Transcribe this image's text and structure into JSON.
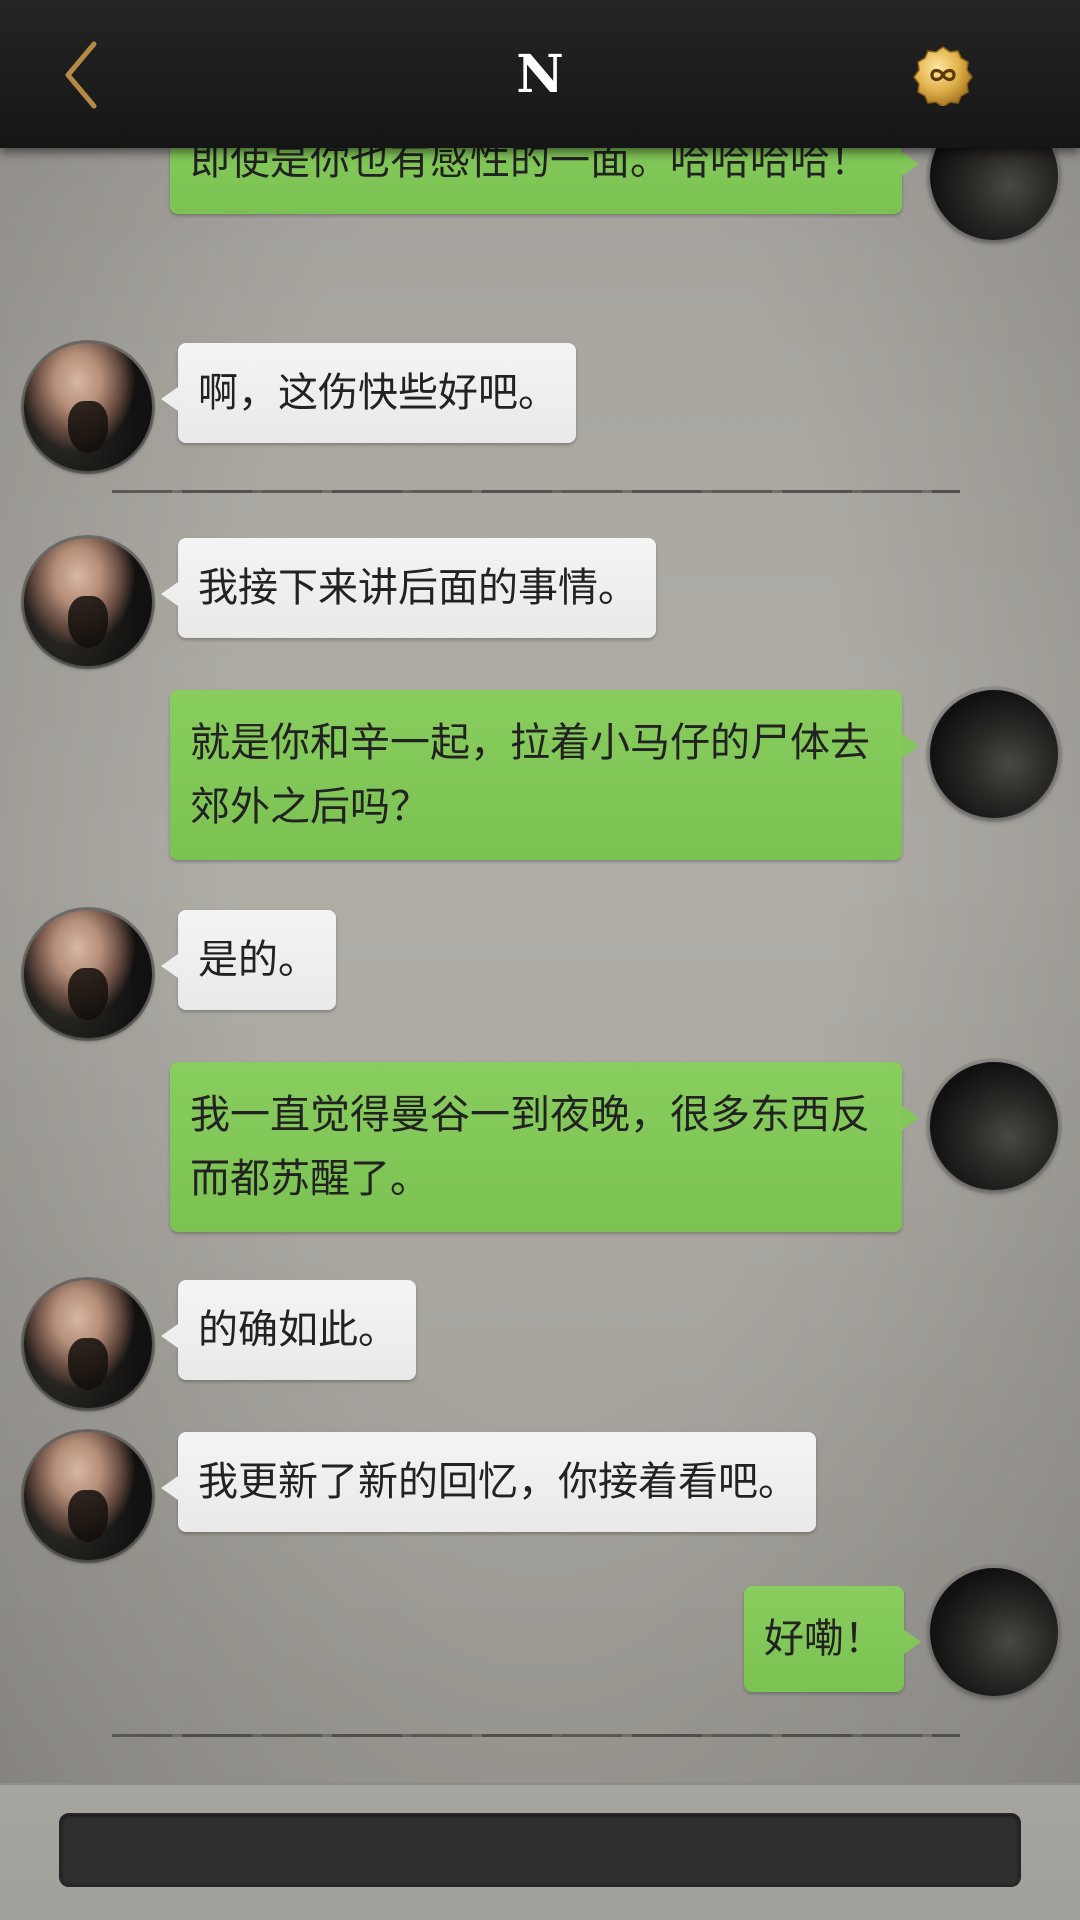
{
  "header": {
    "title": "N",
    "back_icon": "chevron-left-icon",
    "coin_icon": "infinity-coin-icon",
    "accent": "#c9a25a"
  },
  "colors": {
    "outgoing_bubble": "#82c758",
    "incoming_bubble": "#eeeeee",
    "header_bg": "#1c1c1c"
  },
  "messages": [
    {
      "sender": "me",
      "text": "即使是你也有感性的一面。哈哈哈哈！"
    },
    {
      "sender": "contact",
      "text": "啊，这伤快些好吧。"
    },
    {
      "sender": "contact",
      "text": "我接下来讲后面的事情。"
    },
    {
      "sender": "me",
      "text": "就是你和辛一起，拉着小马仔的尸体去郊外之后吗？"
    },
    {
      "sender": "contact",
      "text": "是的。"
    },
    {
      "sender": "me",
      "text": "我一直觉得曼谷一到夜晚，很多东西反而都苏醒了。"
    },
    {
      "sender": "contact",
      "text": "的确如此。"
    },
    {
      "sender": "contact",
      "text": "我更新了新的回忆，你接着看吧。"
    },
    {
      "sender": "me",
      "text": "好嘞！"
    }
  ],
  "input": {
    "value": "",
    "placeholder": ""
  }
}
